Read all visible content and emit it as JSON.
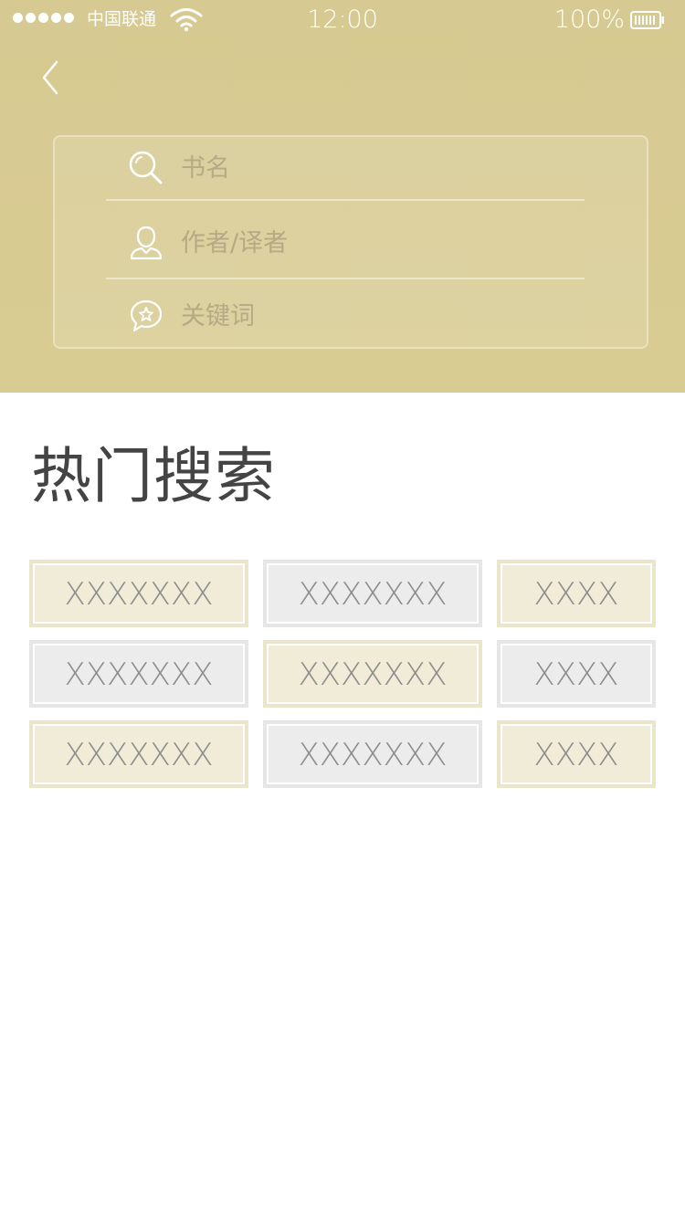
{
  "status_bar": {
    "carrier": "中国联通",
    "time": "12:00",
    "battery": "100%"
  },
  "search": {
    "title_placeholder": "书名",
    "author_placeholder": "作者/译者",
    "keyword_placeholder": "关键词"
  },
  "hot_search": {
    "title": "热门搜索",
    "tags": [
      {
        "label": "XXXXXXX",
        "style": "gold"
      },
      {
        "label": "XXXXXXX",
        "style": "grey"
      },
      {
        "label": "XXXX",
        "style": "gold"
      },
      {
        "label": "XXXXXXX",
        "style": "grey"
      },
      {
        "label": "XXXXXXX",
        "style": "gold"
      },
      {
        "label": "XXXX",
        "style": "grey"
      },
      {
        "label": "XXXXXXX",
        "style": "gold"
      },
      {
        "label": "XXXXXXX",
        "style": "grey"
      },
      {
        "label": "XXXX",
        "style": "gold"
      }
    ]
  },
  "icons": {
    "back": "chevron-left-icon",
    "title_field": "search-icon",
    "author_field": "person-icon",
    "keyword_field": "chat-star-icon"
  },
  "colors": {
    "header": "#d7ca92",
    "tag_gold": "#f0ecd7",
    "tag_grey": "#ececec",
    "title_text": "#444444"
  }
}
